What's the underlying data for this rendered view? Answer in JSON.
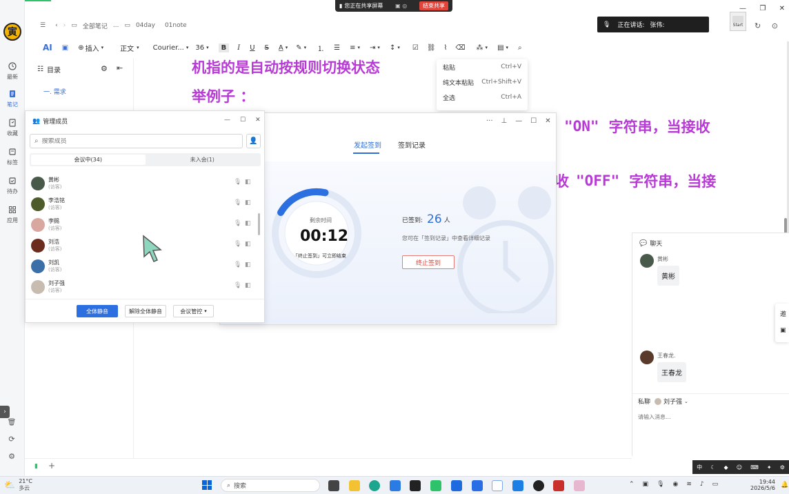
{
  "share_bar": {
    "text": "您正在共享屏幕",
    "stop": "结束共享"
  },
  "speaker": {
    "label": "正在讲话:",
    "name": "张伟:"
  },
  "start_badge": "Start",
  "rail": {
    "items": [
      {
        "label": "最新"
      },
      {
        "label": "笔记"
      },
      {
        "label": "收藏"
      },
      {
        "label": "标签"
      },
      {
        "label": "待办"
      },
      {
        "label": "应用"
      }
    ]
  },
  "breadcrumb": {
    "root": "全部笔记",
    "sep": "...",
    "folder": "04day",
    "note": "01note"
  },
  "toolbar": {
    "ai": "AI",
    "insert": "插入",
    "style": "正文",
    "font": "Courier...",
    "size": "36"
  },
  "outline": {
    "title": "目录",
    "item": "一. 需求"
  },
  "doc": {
    "line1": "机指的是自动按规则切换状态",
    "line2": "举例子 ：",
    "line3_mono": "\"ON\"",
    "line3_text": "字符串，当接收",
    "line4_pre": "收",
    "line4_mono": "\"OFF\"",
    "line4_text": "字符串，当接"
  },
  "context_menu": {
    "items": [
      {
        "label": "粘贴",
        "shortcut": "Ctrl+V"
      },
      {
        "label": "纯文本粘贴",
        "shortcut": "Ctrl+Shift+V"
      },
      {
        "label": "全选",
        "shortcut": "Ctrl+A"
      }
    ]
  },
  "members": {
    "title": "管理成员",
    "search_placeholder": "搜索成员",
    "tab_in": "会议中(34)",
    "tab_out": "未入会(1)",
    "list": [
      {
        "name": "黄彬",
        "role": "(访客)",
        "color": "#4a5a4a"
      },
      {
        "name": "李浩铭",
        "role": "(访客)",
        "color": "#4d5a2a"
      },
      {
        "name": "李赐",
        "role": "(访客)",
        "color": "#d8a8a0"
      },
      {
        "name": "刘浩",
        "role": "(访客)",
        "color": "#6b2c1e"
      },
      {
        "name": "刘凯",
        "role": "(访客)",
        "color": "#3b6fa8"
      },
      {
        "name": "刘子强",
        "role": "(访客)",
        "color": "#c8bcb0"
      }
    ],
    "mute_all": "全体静音",
    "unmute_all": "解除全体静音",
    "control": "会议管控"
  },
  "signin": {
    "tab_start": "发起签到",
    "tab_records": "签到记录",
    "remaining_label": "剩余时间",
    "timer": "00:12",
    "timer_hint": "「终止签到」可立即结束",
    "signed_label": "已签到:",
    "signed_count": "26",
    "signed_unit": "人",
    "records_hint": "您可在「签到记录」中查看详细记录",
    "end_button": "终止签到",
    "progress": 0.2
  },
  "chat": {
    "title": "聊天",
    "msgs": [
      {
        "sender": "黄彬",
        "text": "黄彬"
      },
      {
        "sender": "王春龙.",
        "text": "王春龙"
      }
    ],
    "private_label": "私聊",
    "private_target": "刘子强",
    "input_placeholder": "请输入消息..."
  },
  "taskbar": {
    "weather_temp": "21°C",
    "weather_desc": "多云",
    "search": "搜索",
    "time": "19:44",
    "date": "2026/5/6",
    "ime": "中"
  },
  "side_cut": "邀"
}
